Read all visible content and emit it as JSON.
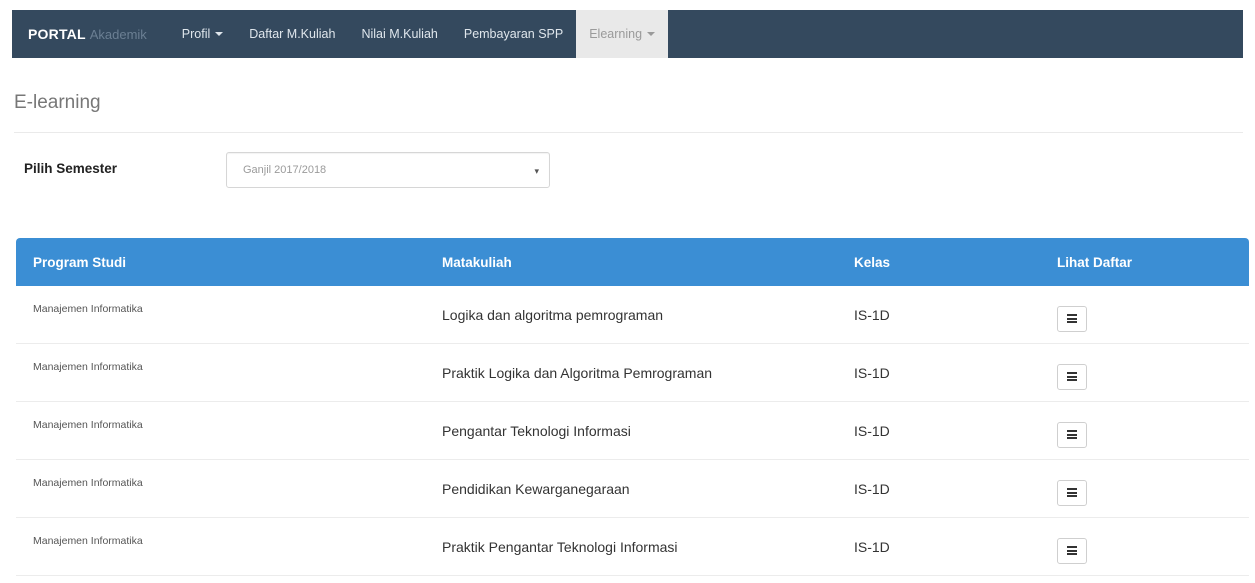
{
  "navbar": {
    "brand_bold": "PORTAL",
    "brand_sub": "Akademik",
    "items": [
      {
        "label": "Profil",
        "dropdown": true,
        "active": false
      },
      {
        "label": "Daftar M.Kuliah",
        "dropdown": false,
        "active": false
      },
      {
        "label": "Nilai M.Kuliah",
        "dropdown": false,
        "active": false
      },
      {
        "label": "Pembayaran SPP",
        "dropdown": false,
        "active": false
      },
      {
        "label": "Elearning",
        "dropdown": true,
        "active": true
      }
    ],
    "bg_color": "#34495e"
  },
  "page": {
    "title": "E-learning"
  },
  "semester": {
    "label": "Pilih Semester",
    "selected": "Ganjil 2017/2018"
  },
  "table": {
    "header_color": "#3b8ed4",
    "columns": [
      "Program Studi",
      "Matakuliah",
      "Kelas",
      "Lihat Daftar"
    ],
    "rows": [
      {
        "program": "Manajemen Informatika",
        "matakuliah": "Logika dan algoritma pemrograman",
        "kelas": "IS-1D",
        "action_icon": "list-icon"
      },
      {
        "program": "Manajemen Informatika",
        "matakuliah": "Praktik Logika dan Algoritma Pemrograman",
        "kelas": "IS-1D",
        "action_icon": "list-icon"
      },
      {
        "program": "Manajemen Informatika",
        "matakuliah": "Pengantar Teknologi Informasi",
        "kelas": "IS-1D",
        "action_icon": "list-icon"
      },
      {
        "program": "Manajemen Informatika",
        "matakuliah": "Pendidikan Kewarganegaraan",
        "kelas": "IS-1D",
        "action_icon": "list-icon"
      },
      {
        "program": "Manajemen Informatika",
        "matakuliah": "Praktik Pengantar Teknologi Informasi",
        "kelas": "IS-1D",
        "action_icon": "list-icon"
      }
    ]
  }
}
